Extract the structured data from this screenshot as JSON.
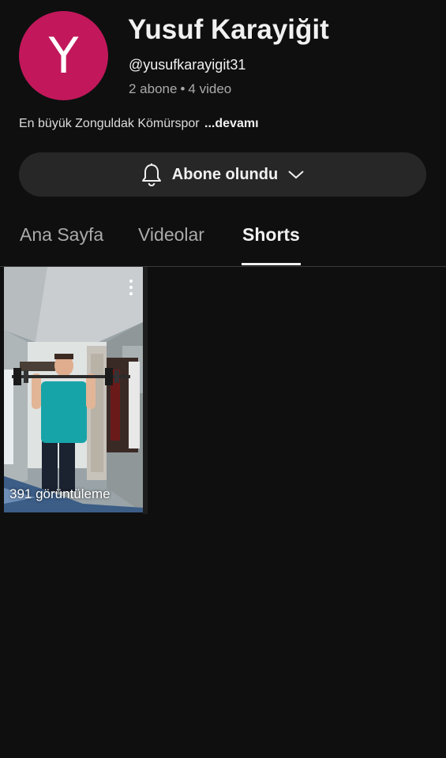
{
  "colors": {
    "background": "#0f0f0f",
    "avatar": "#c2185b",
    "button_bg": "#272727",
    "text_primary": "#f1f1f1",
    "text_secondary": "#aaaaaa"
  },
  "channel": {
    "avatar_letter": "Y",
    "name": "Yusuf Karayiğit",
    "handle": "@yusufkarayigit31",
    "subscribers": "2 abone",
    "separator": "•",
    "videos": "4 video",
    "description": "En büyük Zonguldak Kömürspor",
    "more_label": "...devamı"
  },
  "subscribe": {
    "label": "Abone olundu",
    "icon": "bell-icon",
    "dropdown_icon": "chevron-down-icon"
  },
  "tabs": [
    {
      "label": "Ana Sayfa",
      "active": false
    },
    {
      "label": "Videolar",
      "active": false
    },
    {
      "label": "Shorts",
      "active": true
    }
  ],
  "shorts": [
    {
      "views": "391 görüntüleme",
      "menu_icon": "more-vert-icon"
    }
  ]
}
